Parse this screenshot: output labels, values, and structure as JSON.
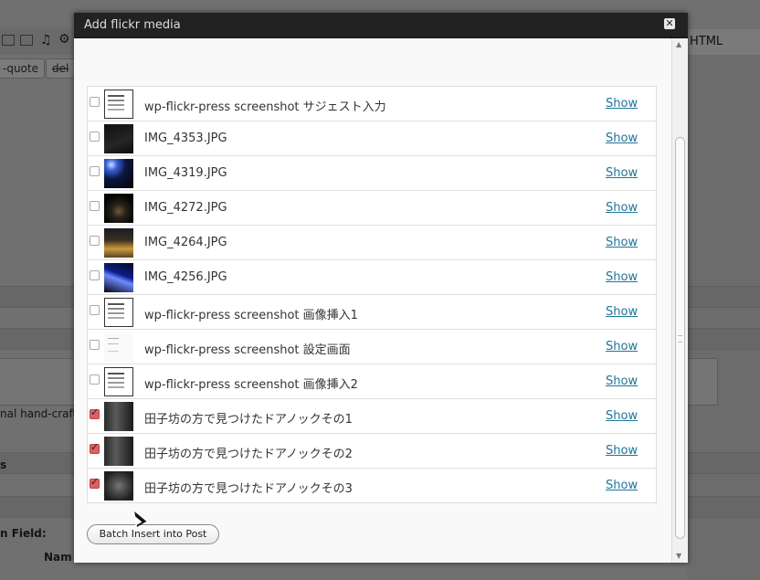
{
  "background": {
    "html_tab": "HTML",
    "buttons": [
      "-quote",
      "del"
    ],
    "text_hand": "nal hand-craft",
    "text_s": "s",
    "text_field": "n Field:",
    "text_name": "Nam"
  },
  "modal": {
    "title": "Add flickr media",
    "close_glyph": "✕"
  },
  "items": [
    {
      "name": "wp-flickr-press screenshot サジェスト入力",
      "action": "Show",
      "checked": false,
      "thumb": "t-shot"
    },
    {
      "name": "IMG_4353.JPG",
      "action": "Show",
      "checked": false,
      "thumb": "t-dark1"
    },
    {
      "name": "IMG_4319.JPG",
      "action": "Show",
      "checked": false,
      "thumb": "t-blue"
    },
    {
      "name": "IMG_4272.JPG",
      "action": "Show",
      "checked": false,
      "thumb": "t-dark2"
    },
    {
      "name": "IMG_4264.JPG",
      "action": "Show",
      "checked": false,
      "thumb": "t-gold"
    },
    {
      "name": "IMG_4256.JPG",
      "action": "Show",
      "checked": false,
      "thumb": "t-blue2"
    },
    {
      "name": "wp-flickr-press screenshot 画像挿入1",
      "action": "Show",
      "checked": false,
      "thumb": "t-shot"
    },
    {
      "name": "wp-flickr-press screenshot 設定画面",
      "action": "Show",
      "checked": false,
      "thumb": "t-shot-light"
    },
    {
      "name": "wp-flickr-press screenshot 画像挿入2",
      "action": "Show",
      "checked": false,
      "thumb": "t-shot"
    },
    {
      "name": "田子坊の方で見つけたドアノックその1",
      "action": "Show",
      "checked": true,
      "thumb": "t-door"
    },
    {
      "name": "田子坊の方で見つけたドアノックその2",
      "action": "Show",
      "checked": true,
      "thumb": "t-door"
    },
    {
      "name": "田子坊の方で見つけたドアノックその3",
      "action": "Show",
      "checked": true,
      "thumb": "t-lion"
    }
  ],
  "batch_button": "Batch Insert into Post",
  "colors": {
    "link": "#21759b",
    "titlebar": "#222222",
    "checked": "#e06060"
  }
}
